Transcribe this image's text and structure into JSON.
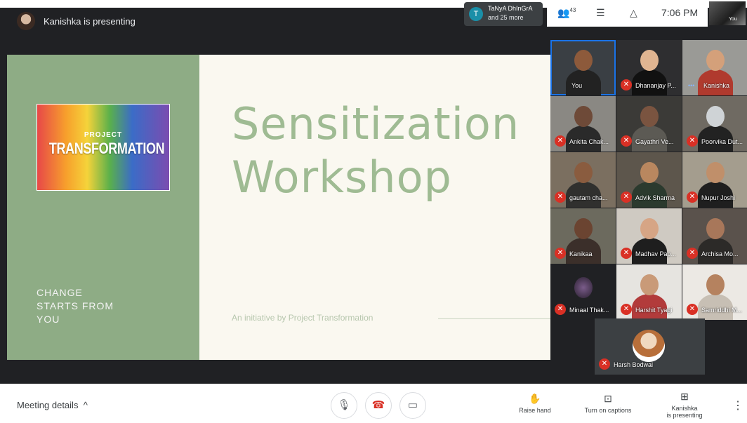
{
  "top_bar": {
    "presenter_label": "Kanishka is presenting",
    "chat_chip": {
      "initial": "T",
      "name": "TaNyA DhInGrA",
      "more": "and 25 more"
    },
    "participant_count": "43",
    "time": "7:06 PM",
    "self_label": "You"
  },
  "slide": {
    "logo_line1": "PROJECT",
    "logo_line2": "TRANSFORMATION",
    "tagline": [
      "CHANGE",
      "STARTS FROM",
      "YOU"
    ],
    "title_line1": "Sensitization",
    "title_line2": "Workshop",
    "initiative": "An initiative by Project Transformation"
  },
  "participants": [
    {
      "name": "You",
      "muted": false
    },
    {
      "name": "Dhananjay P...",
      "muted": true
    },
    {
      "name": "Kanishka",
      "muted": false,
      "speaking_dots": "•••"
    },
    {
      "name": "Ankita Chak...",
      "muted": true
    },
    {
      "name": "Gayathri Ve...",
      "muted": true
    },
    {
      "name": "Poorvika Dut...",
      "muted": true
    },
    {
      "name": "gautam cha...",
      "muted": true
    },
    {
      "name": "Advik Sharma",
      "muted": true
    },
    {
      "name": "Nupur Joshi",
      "muted": true
    },
    {
      "name": "Kanikaa",
      "muted": true
    },
    {
      "name": "Madhav Pap...",
      "muted": true
    },
    {
      "name": "Archisa Mo...",
      "muted": true
    },
    {
      "name": "Minaal Thak...",
      "muted": true
    },
    {
      "name": "Harshit Tyagi",
      "muted": true
    },
    {
      "name": "Samriddhi M...",
      "muted": true
    },
    {
      "name": "Harsh Bodwal",
      "muted": true
    }
  ],
  "bottom_bar": {
    "meeting_details": "Meeting details",
    "raise_hand": "Raise hand",
    "captions": "Turn on captions",
    "presenting_line1": "Kanishka",
    "presenting_line2": "is presenting"
  },
  "colors": {
    "slide_green": "#8eac85",
    "title_green": "#9fbb93",
    "mute_red": "#d93025",
    "bar_dark": "#202124"
  },
  "icons": [
    "people-icon",
    "chat-icon",
    "activities-icon",
    "mic-icon",
    "hangup-icon",
    "camera-icon",
    "hand-icon",
    "captions-icon",
    "present-icon",
    "more-vert-icon",
    "chevron-up-icon",
    "mic-off-icon"
  ]
}
